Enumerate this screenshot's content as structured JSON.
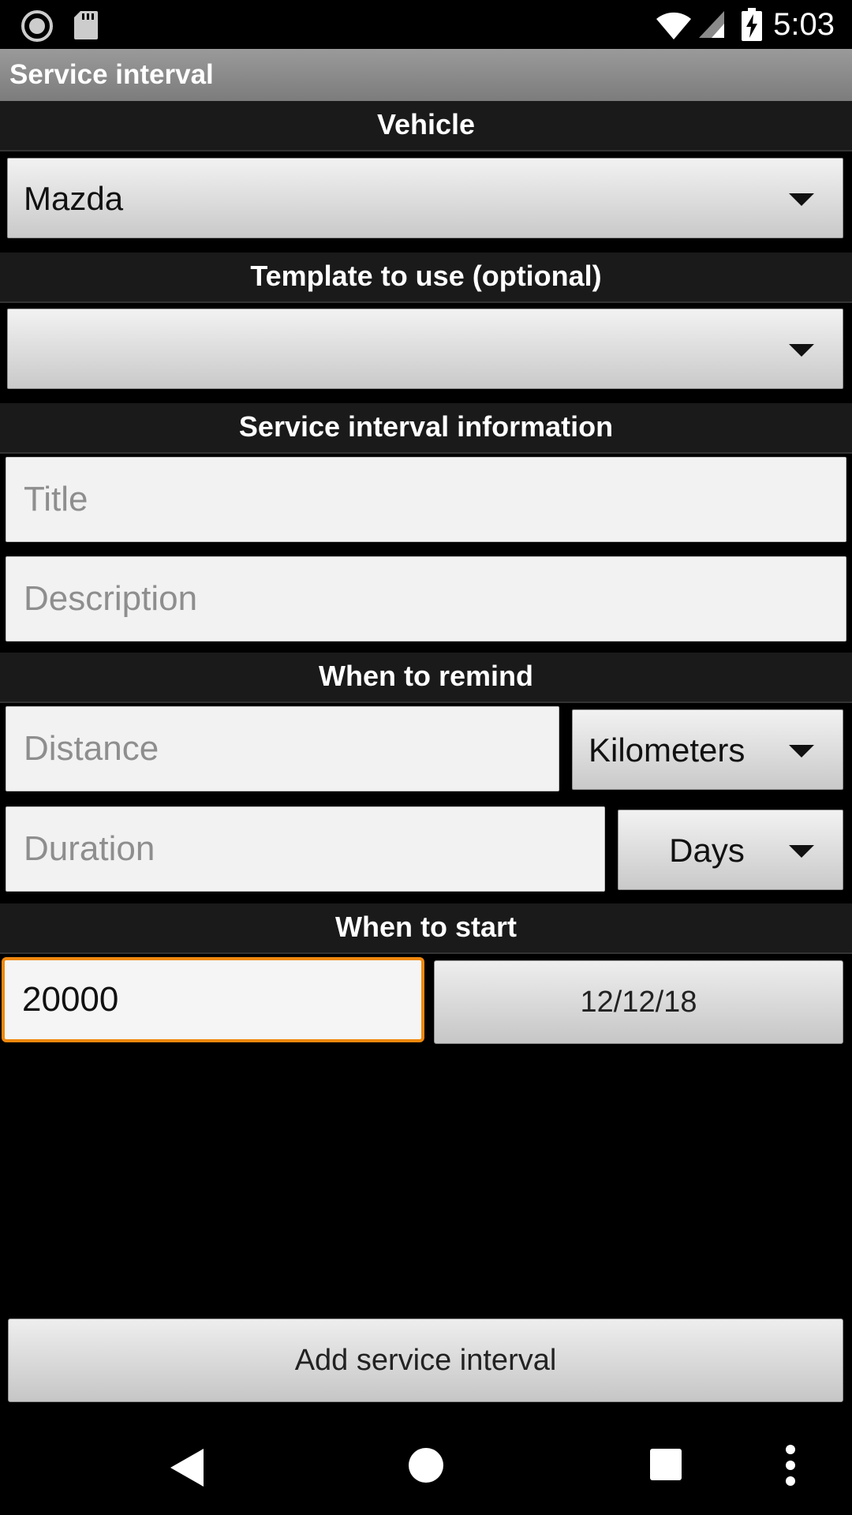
{
  "status_bar": {
    "time": "5:03",
    "icons": [
      "record-icon",
      "sd-card-icon",
      "wifi-icon",
      "signal-icon",
      "battery-charging-icon"
    ]
  },
  "app": {
    "title": "Service interval"
  },
  "sections": {
    "vehicle": "Vehicle",
    "template": "Template to use (optional)",
    "info": "Service interval information",
    "remind": "When to remind",
    "start": "When to start"
  },
  "vehicle_spinner": {
    "value": "Mazda"
  },
  "template_spinner": {
    "value": ""
  },
  "title_field": {
    "placeholder": "Title",
    "value": ""
  },
  "description_field": {
    "placeholder": "Description",
    "value": ""
  },
  "distance_field": {
    "placeholder": "Distance",
    "value": ""
  },
  "distance_unit": {
    "value": "Kilometers"
  },
  "duration_field": {
    "placeholder": "Duration",
    "value": ""
  },
  "duration_unit": {
    "value": "Days"
  },
  "start_distance_field": {
    "value": "20000"
  },
  "start_date_button": {
    "label": "12/12/18"
  },
  "add_button": {
    "label": "Add service interval"
  },
  "nav_bar": {
    "icons": [
      "back-icon",
      "home-icon",
      "recents-icon",
      "menu-icon"
    ]
  }
}
